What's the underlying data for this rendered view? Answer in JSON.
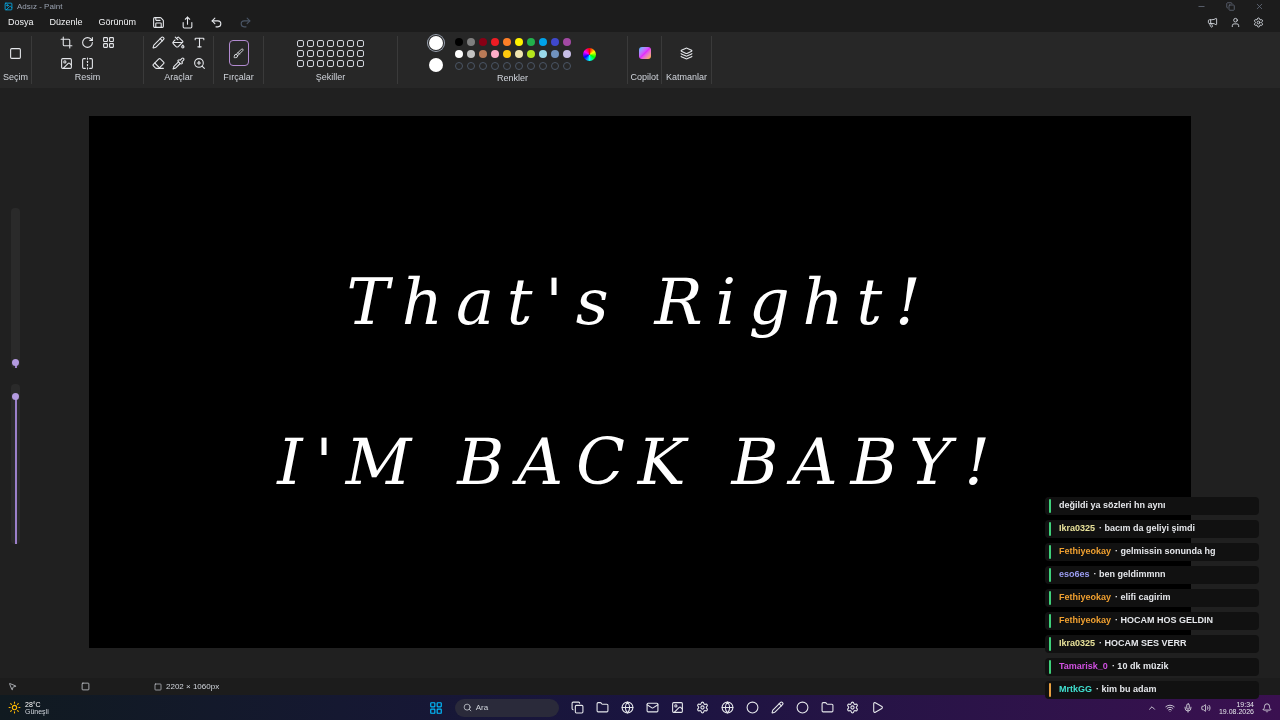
{
  "window": {
    "title": "Adsız - Paint"
  },
  "menu": [
    {
      "label": "Dosya"
    },
    {
      "label": "Düzenle"
    },
    {
      "label": "Görünüm"
    }
  ],
  "ribbon_groups": [
    {
      "label": "Seçim"
    },
    {
      "label": "Resim"
    },
    {
      "label": "Araçlar"
    },
    {
      "label": "Fırçalar"
    },
    {
      "label": "Şekiller"
    },
    {
      "label": "Renkler"
    },
    {
      "label": "Copilot"
    },
    {
      "label": "Katmanlar"
    }
  ],
  "colors": {
    "current": [
      {
        "color": "#ffffff"
      },
      {
        "color": "#ffffff"
      }
    ],
    "palette": [
      {
        "color": "#000000"
      },
      {
        "color": "#7f7f7f"
      },
      {
        "color": "#880015"
      },
      {
        "color": "#ed1c24"
      },
      {
        "color": "#ff7f27"
      },
      {
        "color": "#fff200"
      },
      {
        "color": "#22b14c"
      },
      {
        "color": "#00a2e8"
      },
      {
        "color": "#3f48cc"
      },
      {
        "color": "#a349a4"
      },
      {
        "color": "#ffffff"
      },
      {
        "color": "#c3c3c3"
      },
      {
        "color": "#b97a57"
      },
      {
        "color": "#ffaec9"
      },
      {
        "color": "#ffc90e"
      },
      {
        "color": "#efe4b0"
      },
      {
        "color": "#b5e61d"
      },
      {
        "color": "#99d9ea"
      },
      {
        "color": "#7092be"
      },
      {
        "color": "#c8bfe7"
      }
    ]
  },
  "side_sliders": [
    {
      "level": 0.03
    },
    {
      "level": 0.92
    }
  ],
  "canvas": {
    "lines": [
      "That's Right!",
      "I'M BACK BABY!"
    ]
  },
  "status_bar": {
    "size": "2202 × 1060px"
  },
  "chat": [
    {
      "text": "değildi ya sözleri hn aynı",
      "color": "#3fd07a"
    },
    {
      "user": {
        "name": "Ikra0325",
        "color": "#e8e29a"
      },
      "text": "· bacım da geliyi şimdi",
      "color": "#3fd07a"
    },
    {
      "user": {
        "name": "Fethiyeokay",
        "color": "#f0a030"
      },
      "text": "· gelmissin sonunda hg",
      "color": "#3fd07a"
    },
    {
      "user": {
        "name": "eso6es",
        "color": "#9a9cf0"
      },
      "text": "· ben geldimmnn",
      "color": "#3fd07a"
    },
    {
      "user": {
        "name": "Fethiyeokay",
        "color": "#f0a030"
      },
      "text": "· elifi cagirim",
      "color": "#3fd07a"
    },
    {
      "user": {
        "name": "Fethiyeokay",
        "color": "#f0a030"
      },
      "text": "· HOCAM HOS GELDIN",
      "color": "#3fd07a"
    },
    {
      "user": {
        "name": "Ikra0325",
        "color": "#e8e29a"
      },
      "text": "· HOCAM SES VERR",
      "color": "#3fd07a"
    },
    {
      "user": {
        "name": "Tamarisk_0",
        "color": "#d050e0"
      },
      "text": "· 10 dk müzik",
      "color": "#3fd07a"
    },
    {
      "user": {
        "name": "MrtkGG",
        "color": "#40e0d0"
      },
      "text": "· kim bu adam",
      "color": "#e8a040"
    }
  ],
  "taskbar": {
    "weather_temp": "28°C",
    "weather_text": "Güneşli",
    "search_placeholder": "Ara",
    "time": "19:34",
    "date": "19.08.2026"
  }
}
